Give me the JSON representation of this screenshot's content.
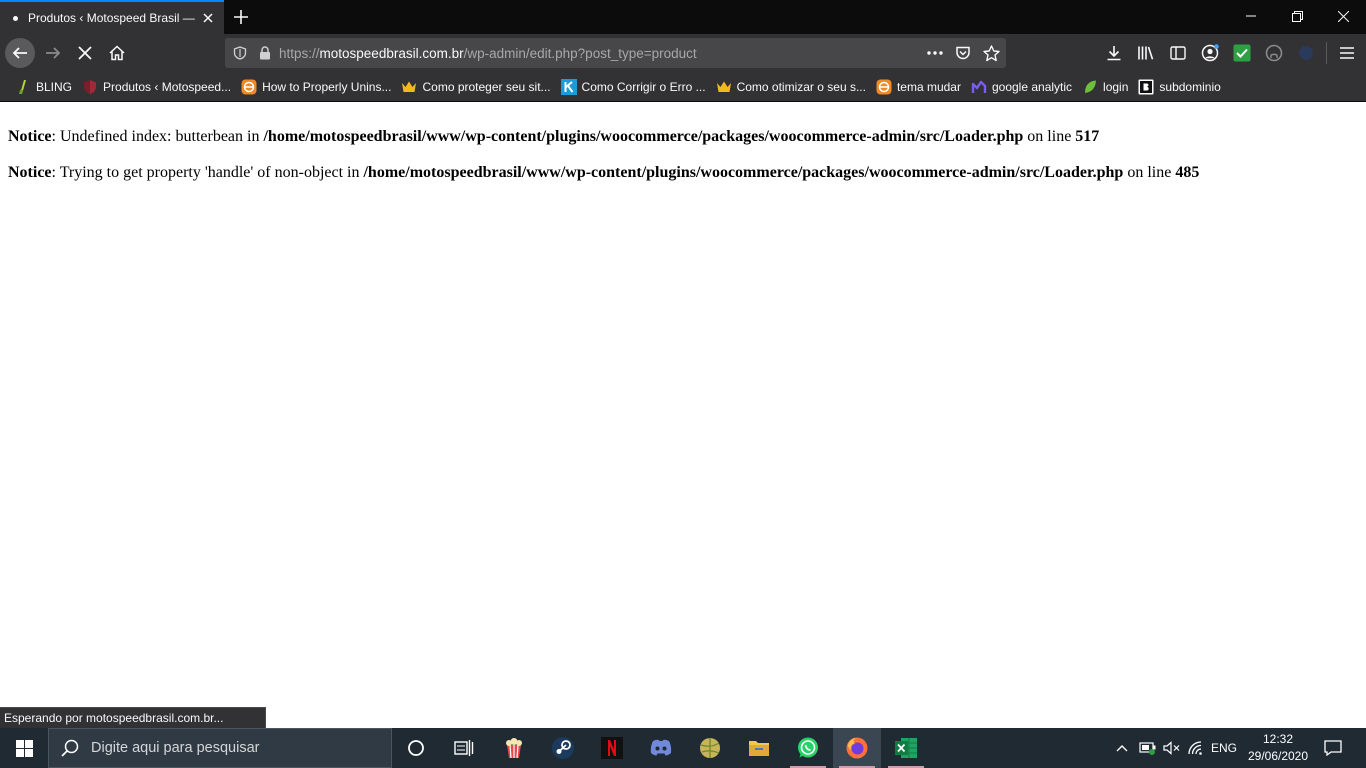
{
  "browser": {
    "tab": {
      "title": "Produtos ‹ Motospeed Brasil —"
    },
    "url": {
      "scheme": "https://",
      "host": "motospeedbrasil.com.br",
      "path": "/wp-admin/edit.php?post_type=product"
    },
    "bookmarks": [
      {
        "label": "BLING",
        "icon": "bling-icon"
      },
      {
        "label": "Produtos ‹ Motospeed...",
        "icon": "shield-icon"
      },
      {
        "label": "How to Properly Unins...",
        "icon": "wpbeginner-icon"
      },
      {
        "label": "Como proteger seu sit...",
        "icon": "crown-icon"
      },
      {
        "label": "Como Corrigir o Erro ...",
        "icon": "kinsta-icon"
      },
      {
        "label": "Como otimizar o seu s...",
        "icon": "crown-icon"
      },
      {
        "label": "tema mudar",
        "icon": "wpbeginner-icon"
      },
      {
        "label": "google analytic",
        "icon": "analytics-icon"
      },
      {
        "label": "login",
        "icon": "leaf-icon"
      },
      {
        "label": "subdominio",
        "icon": "blogger-icon"
      }
    ],
    "status": "Esperando por motospeedbrasil.com.br..."
  },
  "page": {
    "notices": [
      {
        "label": "Notice",
        "text1": ": Undefined index: butterbean in ",
        "file": "/home/motospeedbrasil/www/wp-content/plugins/woocommerce/packages/woocommerce-admin/src/Loader.php",
        "text2": " on line ",
        "line": "517"
      },
      {
        "label": "Notice",
        "text1": ": Trying to get property 'handle' of non-object in ",
        "file": "/home/motospeedbrasil/www/wp-content/plugins/woocommerce/packages/woocommerce-admin/src/Loader.php",
        "text2": " on line ",
        "line": "485"
      }
    ]
  },
  "taskbar": {
    "search_placeholder": "Digite aqui para pesquisar",
    "language": "ENG",
    "time": "12:32",
    "date": "29/06/2020"
  },
  "colors": {
    "accent": "#0a84ff",
    "toolbar": "#323234",
    "taskbar": "#1f2a33"
  }
}
